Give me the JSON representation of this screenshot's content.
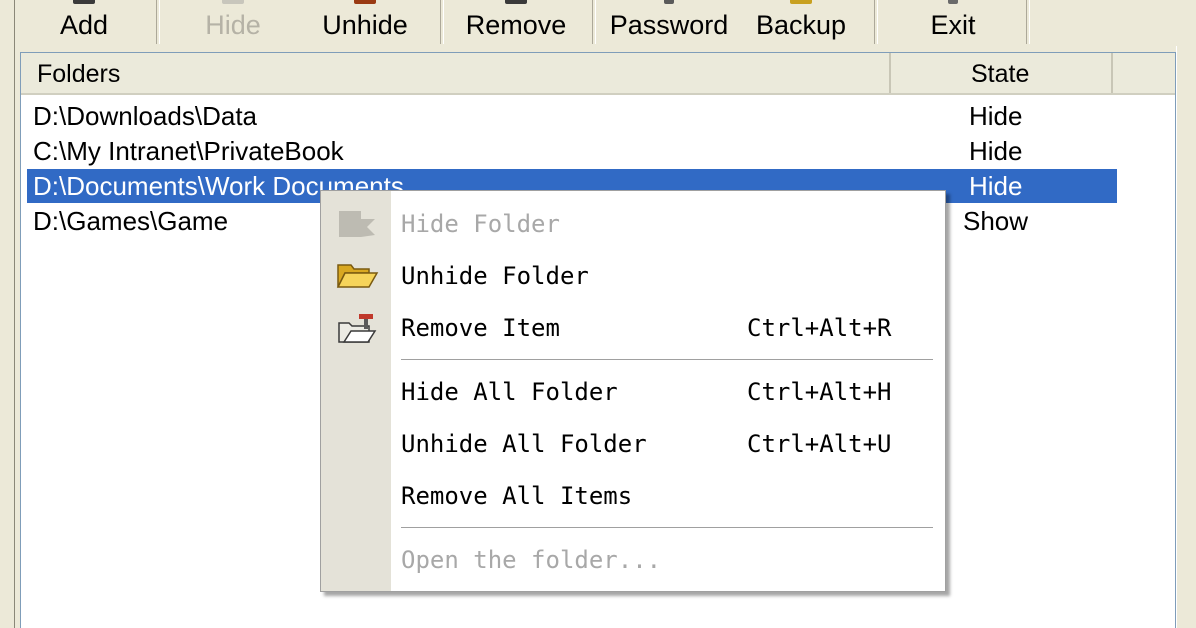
{
  "toolbar": {
    "add": "Add",
    "hide": "Hide",
    "unhide": "Unhide",
    "remove": "Remove",
    "password": "Password",
    "backup": "Backup",
    "exit": "Exit"
  },
  "list": {
    "columns": {
      "folders": "Folders",
      "state": "State"
    },
    "rows": [
      {
        "path": "D:\\Downloads\\Data",
        "state": "Hide"
      },
      {
        "path": "C:\\My Intranet\\PrivateBook",
        "state": "Hide"
      },
      {
        "path": "D:\\Documents\\Work Documents",
        "state": "Hide"
      },
      {
        "path": "D:\\Games\\Game",
        "state": "Show"
      }
    ],
    "selected_row": 2
  },
  "context_menu": {
    "items": [
      {
        "label": "Hide Folder",
        "shortcut": "",
        "enabled": false,
        "icon": "hide-folder-icon"
      },
      {
        "label": "Unhide Folder",
        "shortcut": "",
        "enabled": true,
        "icon": "open-folder-icon"
      },
      {
        "label": "Remove Item",
        "shortcut": "Ctrl+Alt+R",
        "enabled": true,
        "icon": "remove-folder-icon"
      },
      {
        "label": "Hide All Folder",
        "shortcut": "Ctrl+Alt+H",
        "enabled": true,
        "icon": ""
      },
      {
        "label": "Unhide All Folder",
        "shortcut": "Ctrl+Alt+U",
        "enabled": true,
        "icon": ""
      },
      {
        "label": "Remove All Items",
        "shortcut": "",
        "enabled": true,
        "icon": ""
      },
      {
        "label": "Open the folder...",
        "shortcut": "",
        "enabled": false,
        "icon": ""
      }
    ]
  },
  "colors": {
    "selection": "#316ac5",
    "window_face": "#ece9d8",
    "disabled_text": "#a8a8a8"
  }
}
